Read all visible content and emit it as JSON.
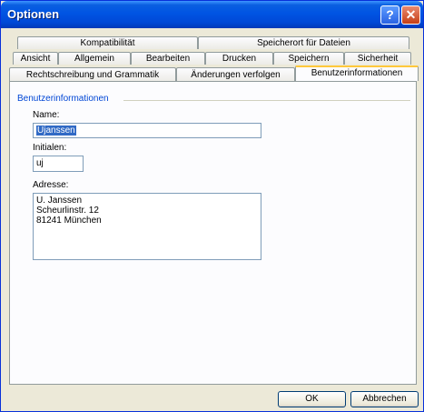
{
  "window": {
    "title": "Optionen",
    "help_glyph": "?",
    "close_glyph": "✕"
  },
  "tabs": {
    "row1": [
      "Kompatibilität",
      "Speicherort für Dateien"
    ],
    "row2": [
      "Ansicht",
      "Allgemein",
      "Bearbeiten",
      "Drucken",
      "Speichern",
      "Sicherheit"
    ],
    "row3": [
      "Rechtschreibung und Grammatik",
      "Änderungen verfolgen",
      "Benutzerinformationen"
    ],
    "active": "Benutzerinformationen"
  },
  "user_info": {
    "group_label": "Benutzerinformationen",
    "name_label": "Name:",
    "name_value": "Ujanssen",
    "initials_label": "Initialen:",
    "initials_value": "uj",
    "address_label": "Adresse:",
    "address_lines": [
      "U. Janssen",
      "Scheurlinstr. 12",
      "81241 München"
    ]
  },
  "buttons": {
    "ok": "OK",
    "cancel": "Abbrechen"
  },
  "colors": {
    "title_bar": "#0054e3",
    "active_tab_accent": "#ffc83c",
    "group_label": "#0046d5",
    "selection": "#316ac5"
  }
}
